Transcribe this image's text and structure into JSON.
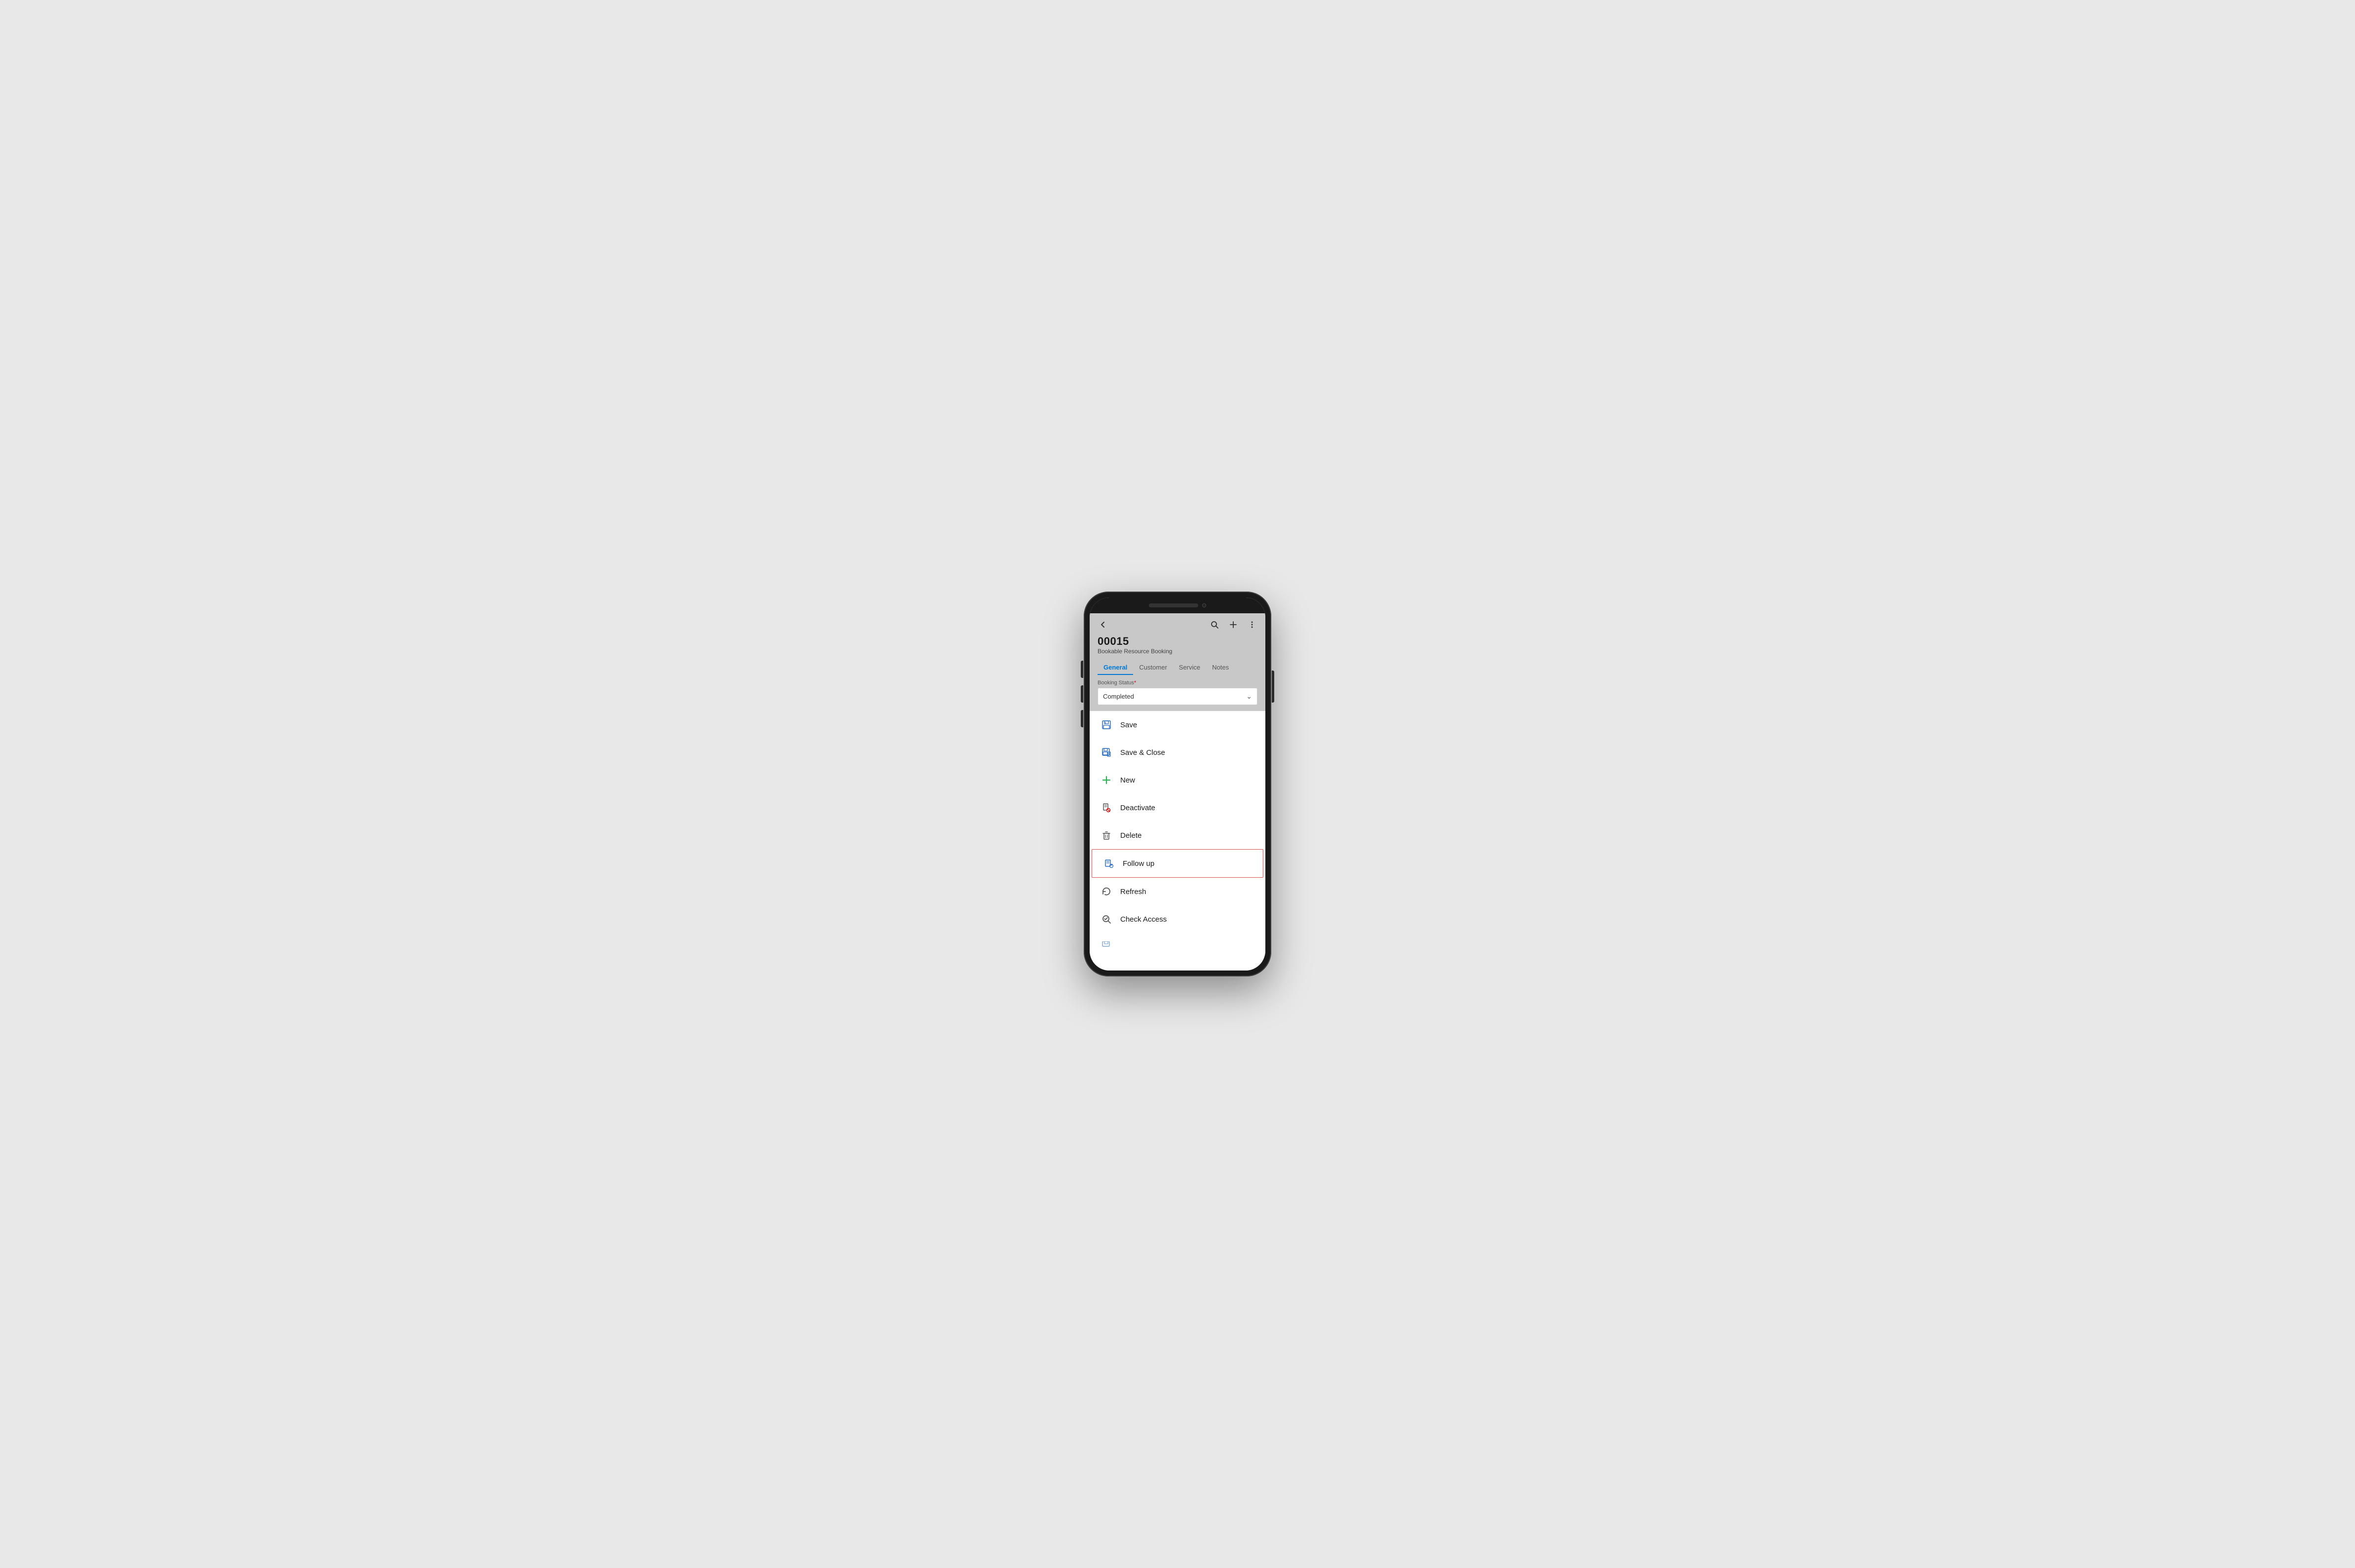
{
  "phone": {
    "record": {
      "id": "00015",
      "type": "Bookable Resource Booking"
    },
    "tabs": [
      {
        "id": "general",
        "label": "General",
        "active": true
      },
      {
        "id": "customer",
        "label": "Customer",
        "active": false
      },
      {
        "id": "service",
        "label": "Service",
        "active": false
      },
      {
        "id": "notes",
        "label": "Notes",
        "active": false
      }
    ],
    "booking_status": {
      "label": "Booking Status",
      "required": true,
      "value": "Completed"
    },
    "menu_items": [
      {
        "id": "save",
        "label": "Save",
        "icon": "save"
      },
      {
        "id": "save-close",
        "label": "Save & Close",
        "icon": "save-close"
      },
      {
        "id": "new",
        "label": "New",
        "icon": "new"
      },
      {
        "id": "deactivate",
        "label": "Deactivate",
        "icon": "deactivate"
      },
      {
        "id": "delete",
        "label": "Delete",
        "icon": "delete"
      },
      {
        "id": "follow-up",
        "label": "Follow up",
        "icon": "follow-up",
        "highlighted": true
      },
      {
        "id": "refresh",
        "label": "Refresh",
        "icon": "refresh"
      },
      {
        "id": "check-access",
        "label": "Check Access",
        "icon": "check-access"
      }
    ],
    "colors": {
      "active_tab": "#0078d4",
      "highlight_border": "#e05252",
      "new_icon": "#2db052",
      "header_bg": "#c8c8c8"
    }
  }
}
